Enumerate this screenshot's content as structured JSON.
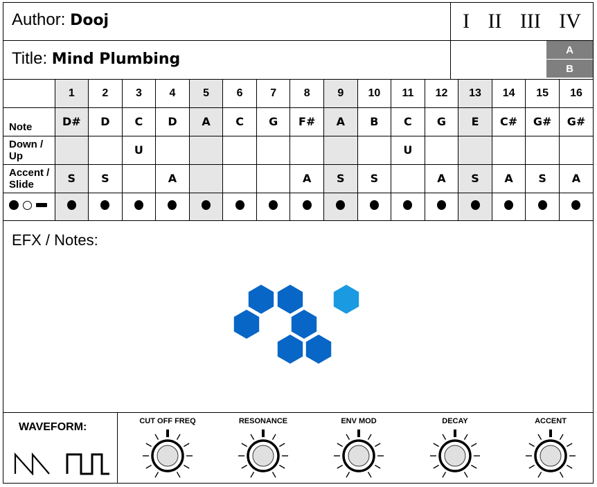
{
  "header": {
    "author_label": "Author:",
    "author": "Dooj",
    "title_label": "Title:",
    "title": "Mind Plumbing",
    "pattern_groups": [
      "I",
      "II",
      "III",
      "IV"
    ],
    "banks": [
      "A",
      "B"
    ]
  },
  "grid": {
    "row_labels": {
      "note": "Note",
      "down_up": "Down / Up",
      "accent_slide": "Accent / Slide"
    },
    "steps": [
      {
        "num": "1",
        "note": "D#",
        "down_up": "",
        "accent_slide": "S",
        "gate": "note",
        "shaded": true
      },
      {
        "num": "2",
        "note": "D",
        "down_up": "",
        "accent_slide": "S",
        "gate": "note",
        "shaded": false
      },
      {
        "num": "3",
        "note": "C",
        "down_up": "U",
        "accent_slide": "",
        "gate": "note",
        "shaded": false
      },
      {
        "num": "4",
        "note": "D",
        "down_up": "",
        "accent_slide": "A",
        "gate": "note",
        "shaded": false
      },
      {
        "num": "5",
        "note": "A",
        "down_up": "",
        "accent_slide": "",
        "gate": "note",
        "shaded": true
      },
      {
        "num": "6",
        "note": "C",
        "down_up": "",
        "accent_slide": "",
        "gate": "note",
        "shaded": false
      },
      {
        "num": "7",
        "note": "G",
        "down_up": "",
        "accent_slide": "",
        "gate": "note",
        "shaded": false
      },
      {
        "num": "8",
        "note": "F#",
        "down_up": "",
        "accent_slide": "A",
        "gate": "note",
        "shaded": false
      },
      {
        "num": "9",
        "note": "A",
        "down_up": "",
        "accent_slide": "S",
        "gate": "note",
        "shaded": true
      },
      {
        "num": "10",
        "note": "B",
        "down_up": "",
        "accent_slide": "S",
        "gate": "note",
        "shaded": false
      },
      {
        "num": "11",
        "note": "C",
        "down_up": "U",
        "accent_slide": "",
        "gate": "note",
        "shaded": false
      },
      {
        "num": "12",
        "note": "G",
        "down_up": "",
        "accent_slide": "A",
        "gate": "note",
        "shaded": false
      },
      {
        "num": "13",
        "note": "E",
        "down_up": "",
        "accent_slide": "S",
        "gate": "note",
        "shaded": true
      },
      {
        "num": "14",
        "note": "C#",
        "down_up": "",
        "accent_slide": "A",
        "gate": "note",
        "shaded": false
      },
      {
        "num": "15",
        "note": "G#",
        "down_up": "",
        "accent_slide": "S",
        "gate": "note",
        "shaded": false
      },
      {
        "num": "16",
        "note": "G#",
        "down_up": "",
        "accent_slide": "A",
        "gate": "note",
        "shaded": false
      }
    ]
  },
  "notes": {
    "label": "EFX / Notes:",
    "logo_colors": {
      "primary": "#0866c6",
      "accent": "#1a9ae0"
    }
  },
  "controls": {
    "waveform_label": "WAVEFORM:",
    "waveforms": [
      "sawtooth",
      "square"
    ],
    "knobs": [
      {
        "label": "CUT OFF FREQ"
      },
      {
        "label": "RESONANCE"
      },
      {
        "label": "ENV MOD"
      },
      {
        "label": "DECAY"
      },
      {
        "label": "ACCENT"
      }
    ]
  }
}
